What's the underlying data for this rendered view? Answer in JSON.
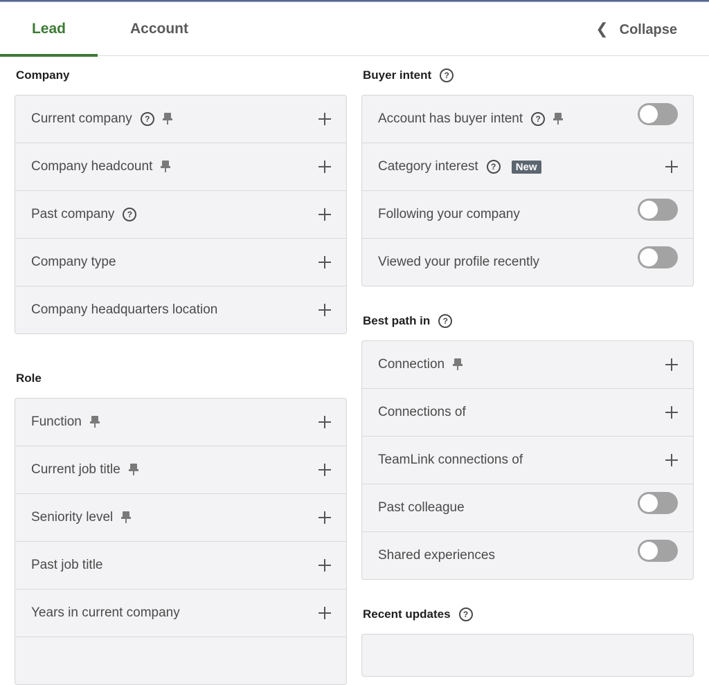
{
  "tabs": {
    "lead": "Lead",
    "account": "Account",
    "collapse": "Collapse"
  },
  "company": {
    "title": "Company",
    "rows": [
      {
        "label": "Current company"
      },
      {
        "label": "Company headcount"
      },
      {
        "label": "Past company"
      },
      {
        "label": "Company type"
      },
      {
        "label": "Company headquarters location"
      }
    ]
  },
  "role": {
    "title": "Role",
    "rows": [
      {
        "label": "Function"
      },
      {
        "label": "Current job title"
      },
      {
        "label": "Seniority level"
      },
      {
        "label": "Past job title"
      },
      {
        "label": "Years in current company"
      }
    ]
  },
  "buyer_intent": {
    "title": "Buyer intent",
    "rows": [
      {
        "label": "Account has buyer intent"
      },
      {
        "label": "Category interest",
        "badge": "New"
      },
      {
        "label": "Following your company"
      },
      {
        "label": "Viewed your profile recently"
      }
    ]
  },
  "best_path": {
    "title": "Best path in",
    "rows": [
      {
        "label": "Connection"
      },
      {
        "label": "Connections of"
      },
      {
        "label": "TeamLink connections of"
      },
      {
        "label": "Past colleague"
      },
      {
        "label": "Shared experiences"
      }
    ]
  },
  "recent_updates": {
    "title": "Recent updates"
  },
  "colors": {
    "accent": "#3d7a35",
    "toggle_off": "#a3a3a3",
    "badge": "#5c6670"
  }
}
